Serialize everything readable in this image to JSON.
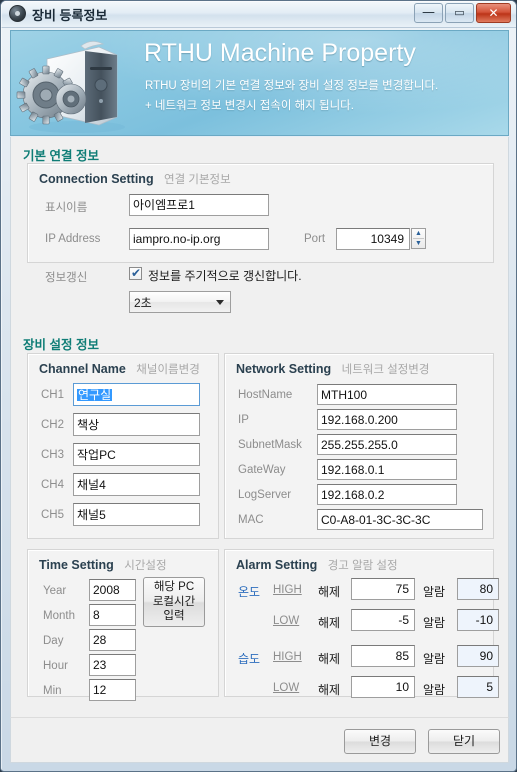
{
  "window": {
    "title": "장비 등록정보",
    "icon": "gear-circle-icon",
    "controls": {
      "minimize": "—",
      "maximize": "▭",
      "close": "✕"
    }
  },
  "banner": {
    "title": "RTHU Machine Property",
    "subtitle1": "RTHU 장비의 기본 연결 정보와 장비 설정 정보를 변경합니다.",
    "subtitle2": "+ 네트워크 정보 변경시 접속이 해지 됩니다.",
    "art": "computer-tower-gears-image",
    "accent_color": "#7cc0dd"
  },
  "section_basic": {
    "title": "기본 연결 정보",
    "accent_color": "#0f7d76",
    "group": {
      "title_en": "Connection Setting",
      "title_kr": "연결 기본정보",
      "fields": {
        "display_name": {
          "label": "표시이름",
          "value": "아이엠프로1"
        },
        "ip_address": {
          "label": "IP Address",
          "value": "iampro.no-ip.org"
        },
        "port": {
          "label": "Port",
          "value": "10349"
        },
        "refresh": {
          "label": "정보갱신",
          "checkbox_label": "정보를 주기적으로 갱신합니다.",
          "checked": true
        },
        "interval": {
          "value": "2초"
        }
      }
    }
  },
  "section_device": {
    "title": "장비 설정 정보",
    "channel": {
      "title_en": "Channel Name",
      "title_kr": "채널이름변경",
      "rows": [
        {
          "label": "CH1",
          "value": "연구실",
          "focused": true
        },
        {
          "label": "CH2",
          "value": "책상",
          "focused": false
        },
        {
          "label": "CH3",
          "value": "작업PC",
          "focused": false
        },
        {
          "label": "CH4",
          "value": "채널4",
          "focused": false
        },
        {
          "label": "CH5",
          "value": "채널5",
          "focused": false
        }
      ]
    },
    "network": {
      "title_en": "Network Setting",
      "title_kr": "네트워크 설정변경",
      "rows": [
        {
          "label": "HostName",
          "value": "MTH100"
        },
        {
          "label": "IP",
          "value": "192.168.0.200"
        },
        {
          "label": "SubnetMask",
          "value": "255.255.255.0"
        },
        {
          "label": "GateWay",
          "value": "192.168.0.1"
        },
        {
          "label": "LogServer",
          "value": "192.168.0.2"
        },
        {
          "label": "MAC",
          "value": "C0-A8-01-3C-3C-3C"
        }
      ]
    },
    "time": {
      "title_en": "Time Setting",
      "title_kr": "시간설정",
      "rows": [
        {
          "label": "Year",
          "value": "2008"
        },
        {
          "label": "Month",
          "value": "8"
        },
        {
          "label": "Day",
          "value": "28"
        },
        {
          "label": "Hour",
          "value": "23"
        },
        {
          "label": "Min",
          "value": "12"
        }
      ],
      "localtime_button": "해당 PC\n로컬시간\n입력"
    },
    "alarm": {
      "title_en": "Alarm Setting",
      "title_kr": "경고 알람 설정",
      "clear_label": "해제",
      "alarm_label": "알람",
      "rows": [
        {
          "kind": "온도",
          "level": "HIGH",
          "clear": "75",
          "alarm": "80"
        },
        {
          "kind": "",
          "level": "LOW",
          "clear": "-5",
          "alarm": "-10"
        },
        {
          "kind": "습도",
          "level": "HIGH",
          "clear": "85",
          "alarm": "90"
        },
        {
          "kind": "",
          "level": "LOW",
          "clear": "10",
          "alarm": "5"
        }
      ]
    }
  },
  "footer": {
    "apply_label": "변경",
    "close_label": "닫기"
  }
}
